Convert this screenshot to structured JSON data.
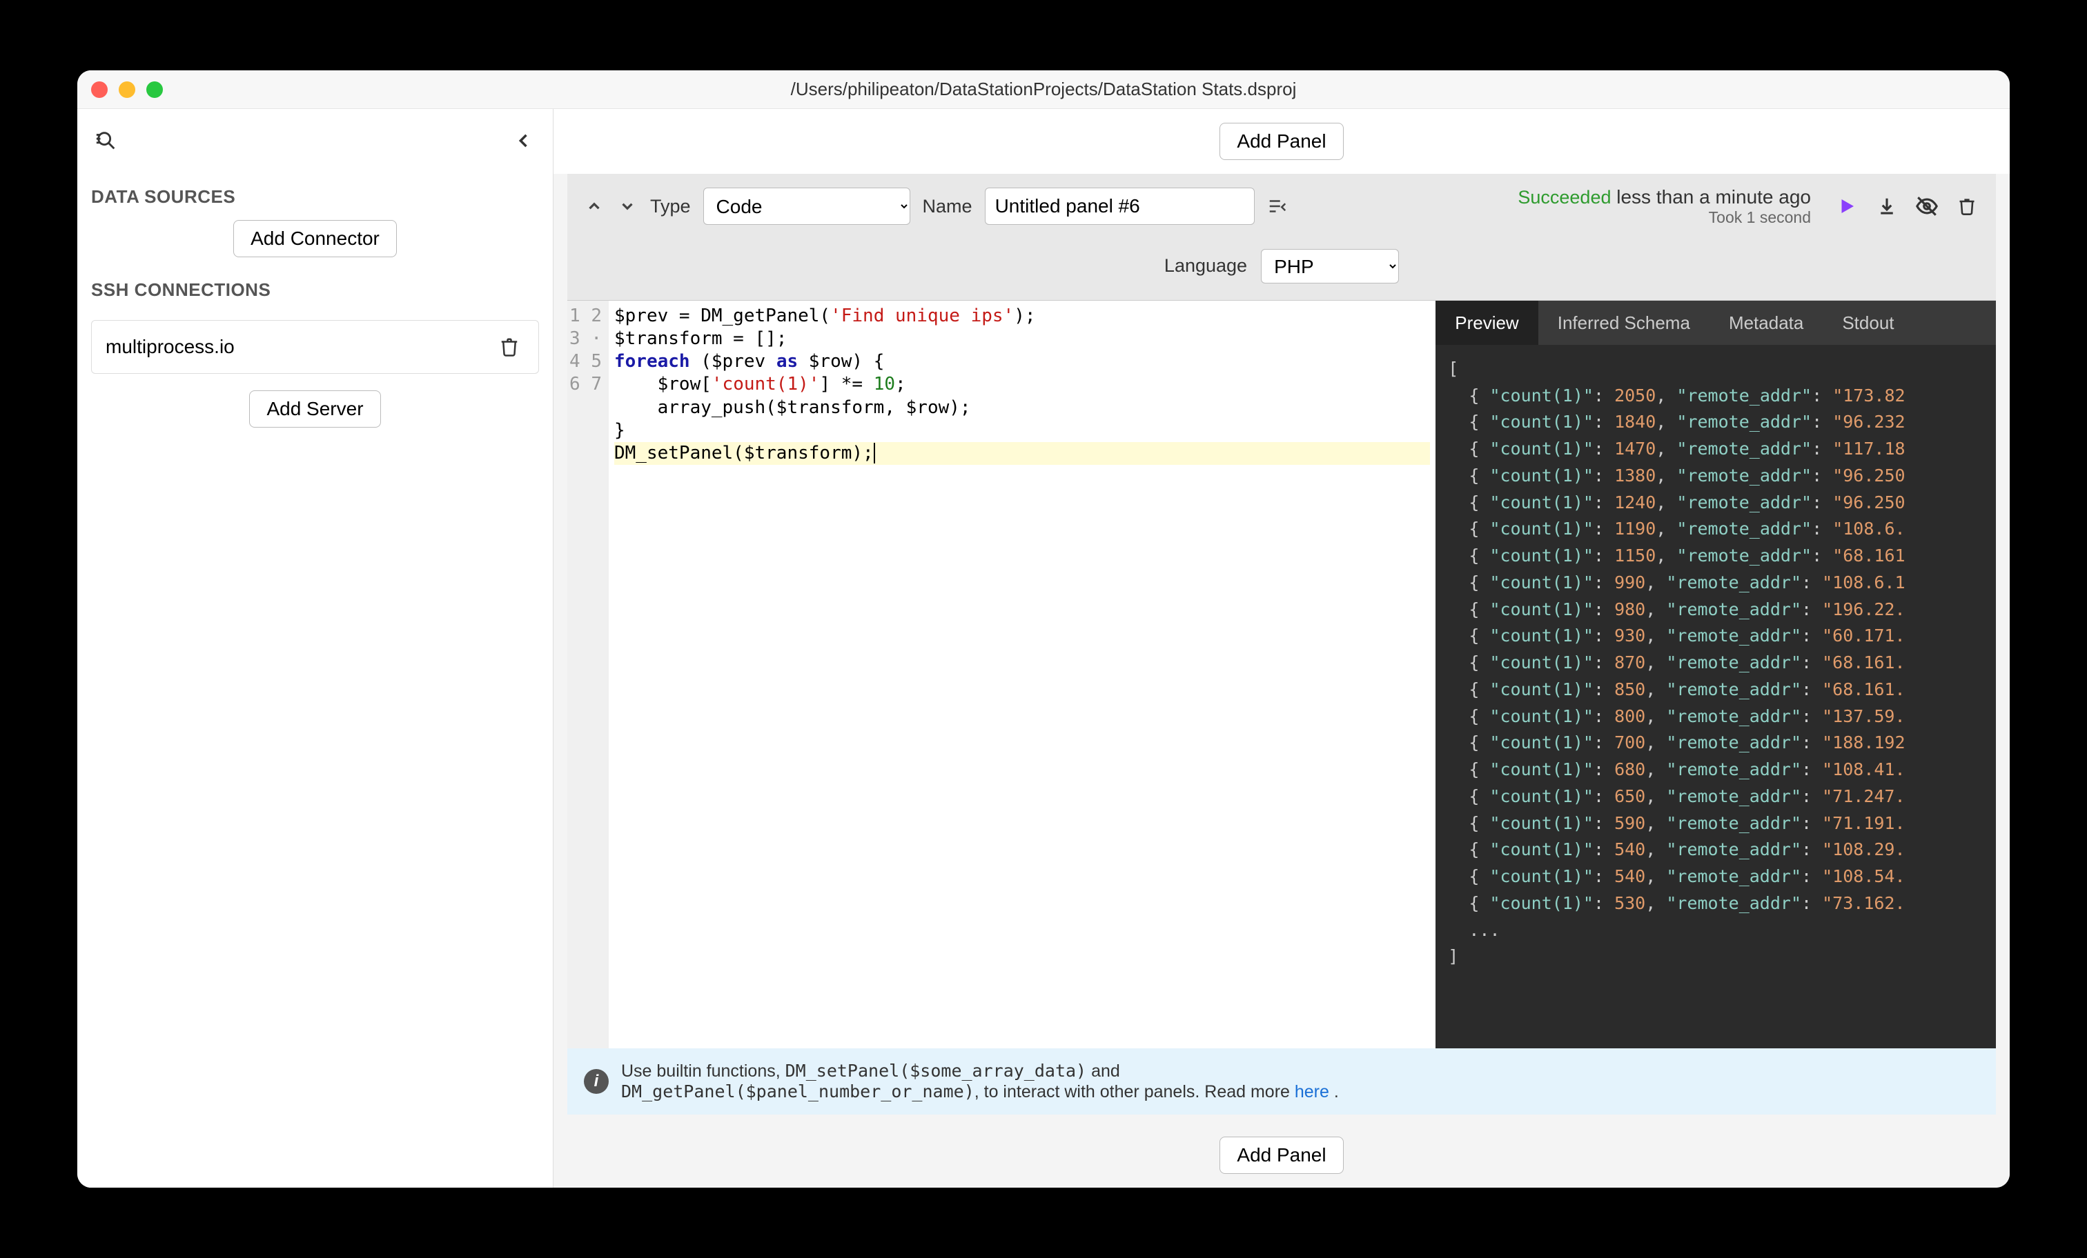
{
  "window_title": "/Users/philipeaton/DataStationProjects/DataStation Stats.dsproj",
  "sidebar": {
    "heading_datasources": "DATA SOURCES",
    "add_connector": "Add Connector",
    "heading_ssh": "SSH CONNECTIONS",
    "ssh_item": "multiprocess.io",
    "add_server": "Add Server"
  },
  "toolbar": {
    "add_panel": "Add Panel",
    "type_label": "Type",
    "type_value": "Code",
    "name_label": "Name",
    "name_value": "Untitled panel #6",
    "status_main": "Succeeded",
    "status_rest": " less than a minute ago",
    "status_sub": "Took 1 second",
    "language_label": "Language",
    "language_value": "PHP"
  },
  "code_lines": [
    {
      "n": "1",
      "html": "$prev = DM_getPanel(<span class=\"str\">'Find unique ips'</span>);"
    },
    {
      "n": "2",
      "html": "$transform = [];"
    },
    {
      "n": "3 ·",
      "html": "<span class=\"kw\">foreach</span> ($prev <span class=\"kw\">as</span> $row) {"
    },
    {
      "n": "4",
      "html": "    $row[<span class=\"str\">'count(1)'</span>] *= <span class=\"num\">10</span>;"
    },
    {
      "n": "5",
      "html": "    array_push($transform, $row);"
    },
    {
      "n": "6",
      "html": "}"
    },
    {
      "n": "7",
      "html": "DM_setPanel($transform);<span style=\"border-left:2px solid #000;\">&#8203;</span>",
      "cur": true
    }
  ],
  "preview_tabs": [
    "Preview",
    "Inferred Schema",
    "Metadata",
    "Stdout"
  ],
  "preview_active_tab": 0,
  "preview_rows": [
    {
      "count": 2050,
      "addr": "173.82"
    },
    {
      "count": 1840,
      "addr": "96.232"
    },
    {
      "count": 1470,
      "addr": "117.18"
    },
    {
      "count": 1380,
      "addr": "96.250"
    },
    {
      "count": 1240,
      "addr": "96.250"
    },
    {
      "count": 1190,
      "addr": "108.6."
    },
    {
      "count": 1150,
      "addr": "68.161"
    },
    {
      "count": 990,
      "addr": "108.6.1"
    },
    {
      "count": 980,
      "addr": "196.22."
    },
    {
      "count": 930,
      "addr": "60.171."
    },
    {
      "count": 870,
      "addr": "68.161."
    },
    {
      "count": 850,
      "addr": "68.161."
    },
    {
      "count": 800,
      "addr": "137.59."
    },
    {
      "count": 700,
      "addr": "188.192"
    },
    {
      "count": 680,
      "addr": "108.41."
    },
    {
      "count": 650,
      "addr": "71.247."
    },
    {
      "count": 590,
      "addr": "71.191."
    },
    {
      "count": 540,
      "addr": "108.29."
    },
    {
      "count": 540,
      "addr": "108.54."
    },
    {
      "count": 530,
      "addr": "73.162."
    }
  ],
  "hint": {
    "pre": "Use builtin functions, ",
    "code1": "DM_setPanel($some_array_data)",
    "mid": " and ",
    "code2": "DM_getPanel($panel_number_or_name)",
    "post": ", to interact with other panels. Read more ",
    "link": "here",
    "end": " ."
  }
}
